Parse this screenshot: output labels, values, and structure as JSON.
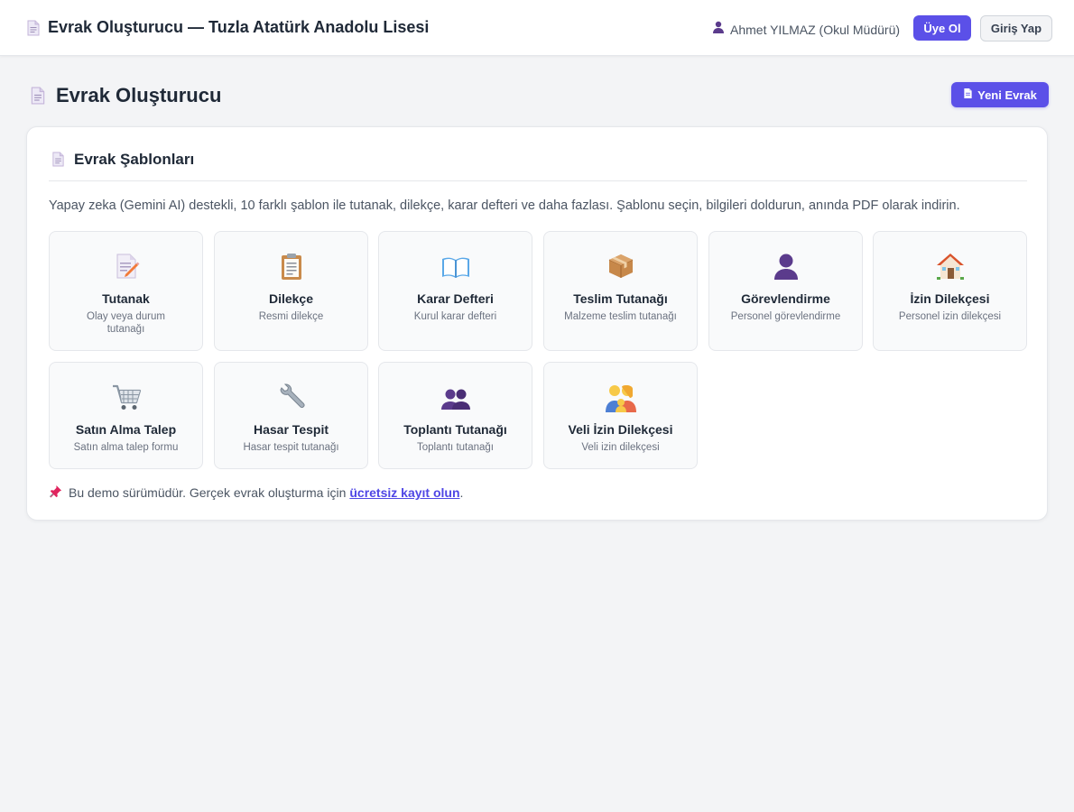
{
  "header": {
    "app_title": "Evrak Oluşturucu — Tuzla Atatürk Anadolu Lisesi",
    "user_name": "Ahmet YILMAZ (Okul Müdürü)",
    "signup_label": "Üye Ol",
    "login_label": "Giriş Yap"
  },
  "page": {
    "title": "Evrak Oluşturucu",
    "new_button_label": "Yeni Evrak"
  },
  "card": {
    "title": "Evrak Şablonları",
    "description": "Yapay zeka (Gemini AI) destekli, 10 farklı şablon ile tutanak, dilekçe, karar defteri ve daha fazlası. Şablonu seçin, bilgileri doldurun, anında PDF olarak indirin."
  },
  "templates": [
    {
      "name": "Tutanak",
      "desc": "Olay veya durum tutanağı",
      "icon": "memo-icon"
    },
    {
      "name": "Dilekçe",
      "desc": "Resmi dilekçe",
      "icon": "clipboard-icon"
    },
    {
      "name": "Karar Defteri",
      "desc": "Kurul karar defteri",
      "icon": "open-book-icon"
    },
    {
      "name": "Teslim Tutanağı",
      "desc": "Malzeme teslim tutanağı",
      "icon": "package-icon"
    },
    {
      "name": "Görevlendirme",
      "desc": "Personel görevlendirme",
      "icon": "person-icon"
    },
    {
      "name": "İzin Dilekçesi",
      "desc": "Personel izin dilekçesi",
      "icon": "house-icon"
    },
    {
      "name": "Satın Alma Talep",
      "desc": "Satın alma talep formu",
      "icon": "shopping-cart-icon"
    },
    {
      "name": "Hasar Tespit",
      "desc": "Hasar tespit tutanağı",
      "icon": "wrench-icon"
    },
    {
      "name": "Toplantı Tutanağı",
      "desc": "Toplantı tutanağı",
      "icon": "people-icon"
    },
    {
      "name": "Veli İzin Dilekçesi",
      "desc": "Veli izin dilekçesi",
      "icon": "family-icon"
    }
  ],
  "note": {
    "text": "Bu demo sürümüdür. Gerçek evrak oluşturma için",
    "link_text": "ücretsiz kayıt olun",
    "trailing": "."
  },
  "colors": {
    "accent": "#5b50e8",
    "background": "#f3f4f6",
    "card": "#ffffff"
  }
}
